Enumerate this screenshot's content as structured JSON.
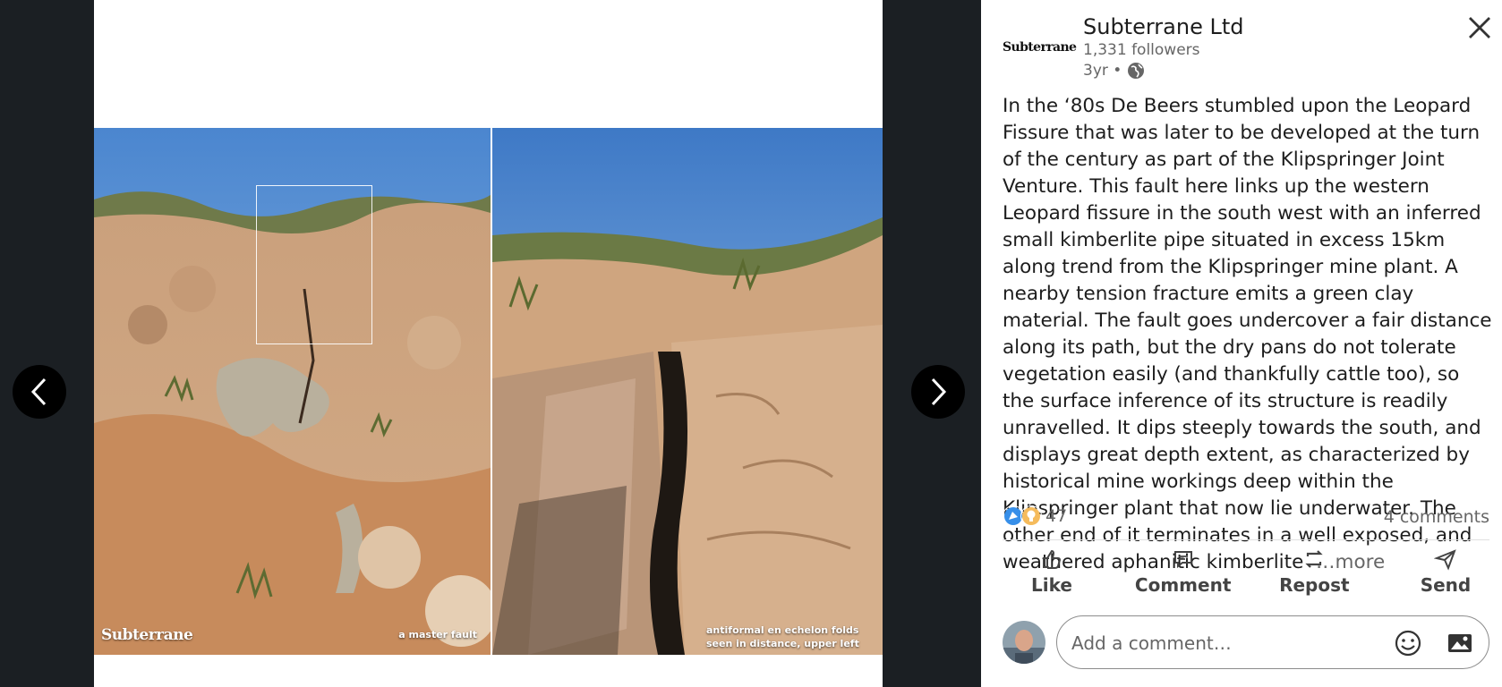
{
  "viewer": {
    "logo_text": "Subterrane",
    "caption_left": "a master fault",
    "caption_right": "antiformal en echelon folds seen in distance, upper left",
    "prev_icon": "chevron-left-icon",
    "next_icon": "chevron-right-icon"
  },
  "post": {
    "company_logo_text": "Subterrane",
    "company_name": "Subterrane Ltd",
    "followers": "1,331 followers",
    "age": "3yr •",
    "visibility_icon": "globe-icon",
    "text": "In the ‘80s De Beers stumbled upon the Leopard Fissure that was later to be developed at the turn of the century as part of the Klipspringer Joint Venture. This fault here links up the western Leopard fissure in the south west with an inferred small kimberlite pipe situated in excess 15km along trend from the Klipspringer mine plant. A nearby tension fracture emits a green clay material. The fault goes undercover a fair distance along its path, but the dry pans do not tolerate vegetation easily (and thankfully cattle too), so the surface inference of its structure is readily unravelled. It dips steeply towards the south, and displays great depth extent, as characterized by historical mine workings deep within the Klipspringer plant that now lie underwater. The other end of it terminates in a well exposed, and weathered aphanitic kimberlite",
    "more_label": "…more",
    "reaction_count": "47",
    "comments_label": "4 comments"
  },
  "actions": {
    "like": "Like",
    "comment": "Comment",
    "repost": "Repost",
    "send": "Send"
  },
  "comment_box": {
    "placeholder": "Add a comment…"
  },
  "colors": {
    "viewer_bg": "#1b1f23",
    "link_blue": "#0a66c2",
    "text_muted": "#666666"
  }
}
